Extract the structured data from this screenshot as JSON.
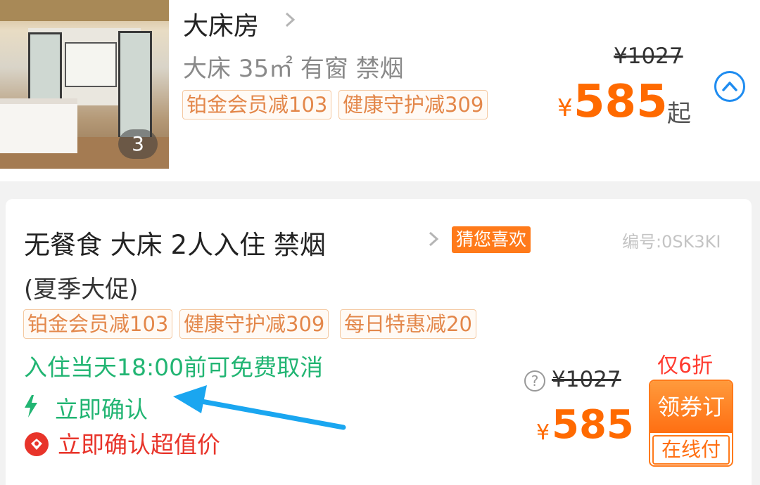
{
  "room": {
    "title": "大床房",
    "specs": "大床 35㎡  有窗 禁烟",
    "photo_count": "3",
    "tags": [
      "铂金会员减103",
      "健康守护减309"
    ],
    "original_price": "¥1027",
    "currency": "¥",
    "price": "585",
    "price_suffix": "起"
  },
  "rate": {
    "title": "无餐食  大床  2人入住  禁烟",
    "subtitle": "(夏季大促)",
    "badge": "猜您喜欢",
    "code": "编号:0SK3KI",
    "tags": [
      "铂金会员减103",
      "健康守护减309",
      "每日特惠减20"
    ],
    "cancel_policy": "入住当天18:00前可免费取消",
    "instant_confirm": "立即确认",
    "value_label": "立即确认超值价",
    "discount": "仅6折",
    "original_price": "¥1027",
    "currency": "¥",
    "price": "585",
    "book_label": "领券订",
    "pay_label": "在线付",
    "help_glyph": "?"
  },
  "colors": {
    "accent_orange": "#ff6a00",
    "confirm_green": "#22b573",
    "highlight_red": "#e8342a",
    "annotation_arrow": "#1aa6f0",
    "collapse_blue": "#1f8cf0"
  },
  "icons": [
    "bolt-icon",
    "value-badge-icon",
    "help-icon",
    "collapse-up-icon",
    "chevron-right-icon"
  ]
}
